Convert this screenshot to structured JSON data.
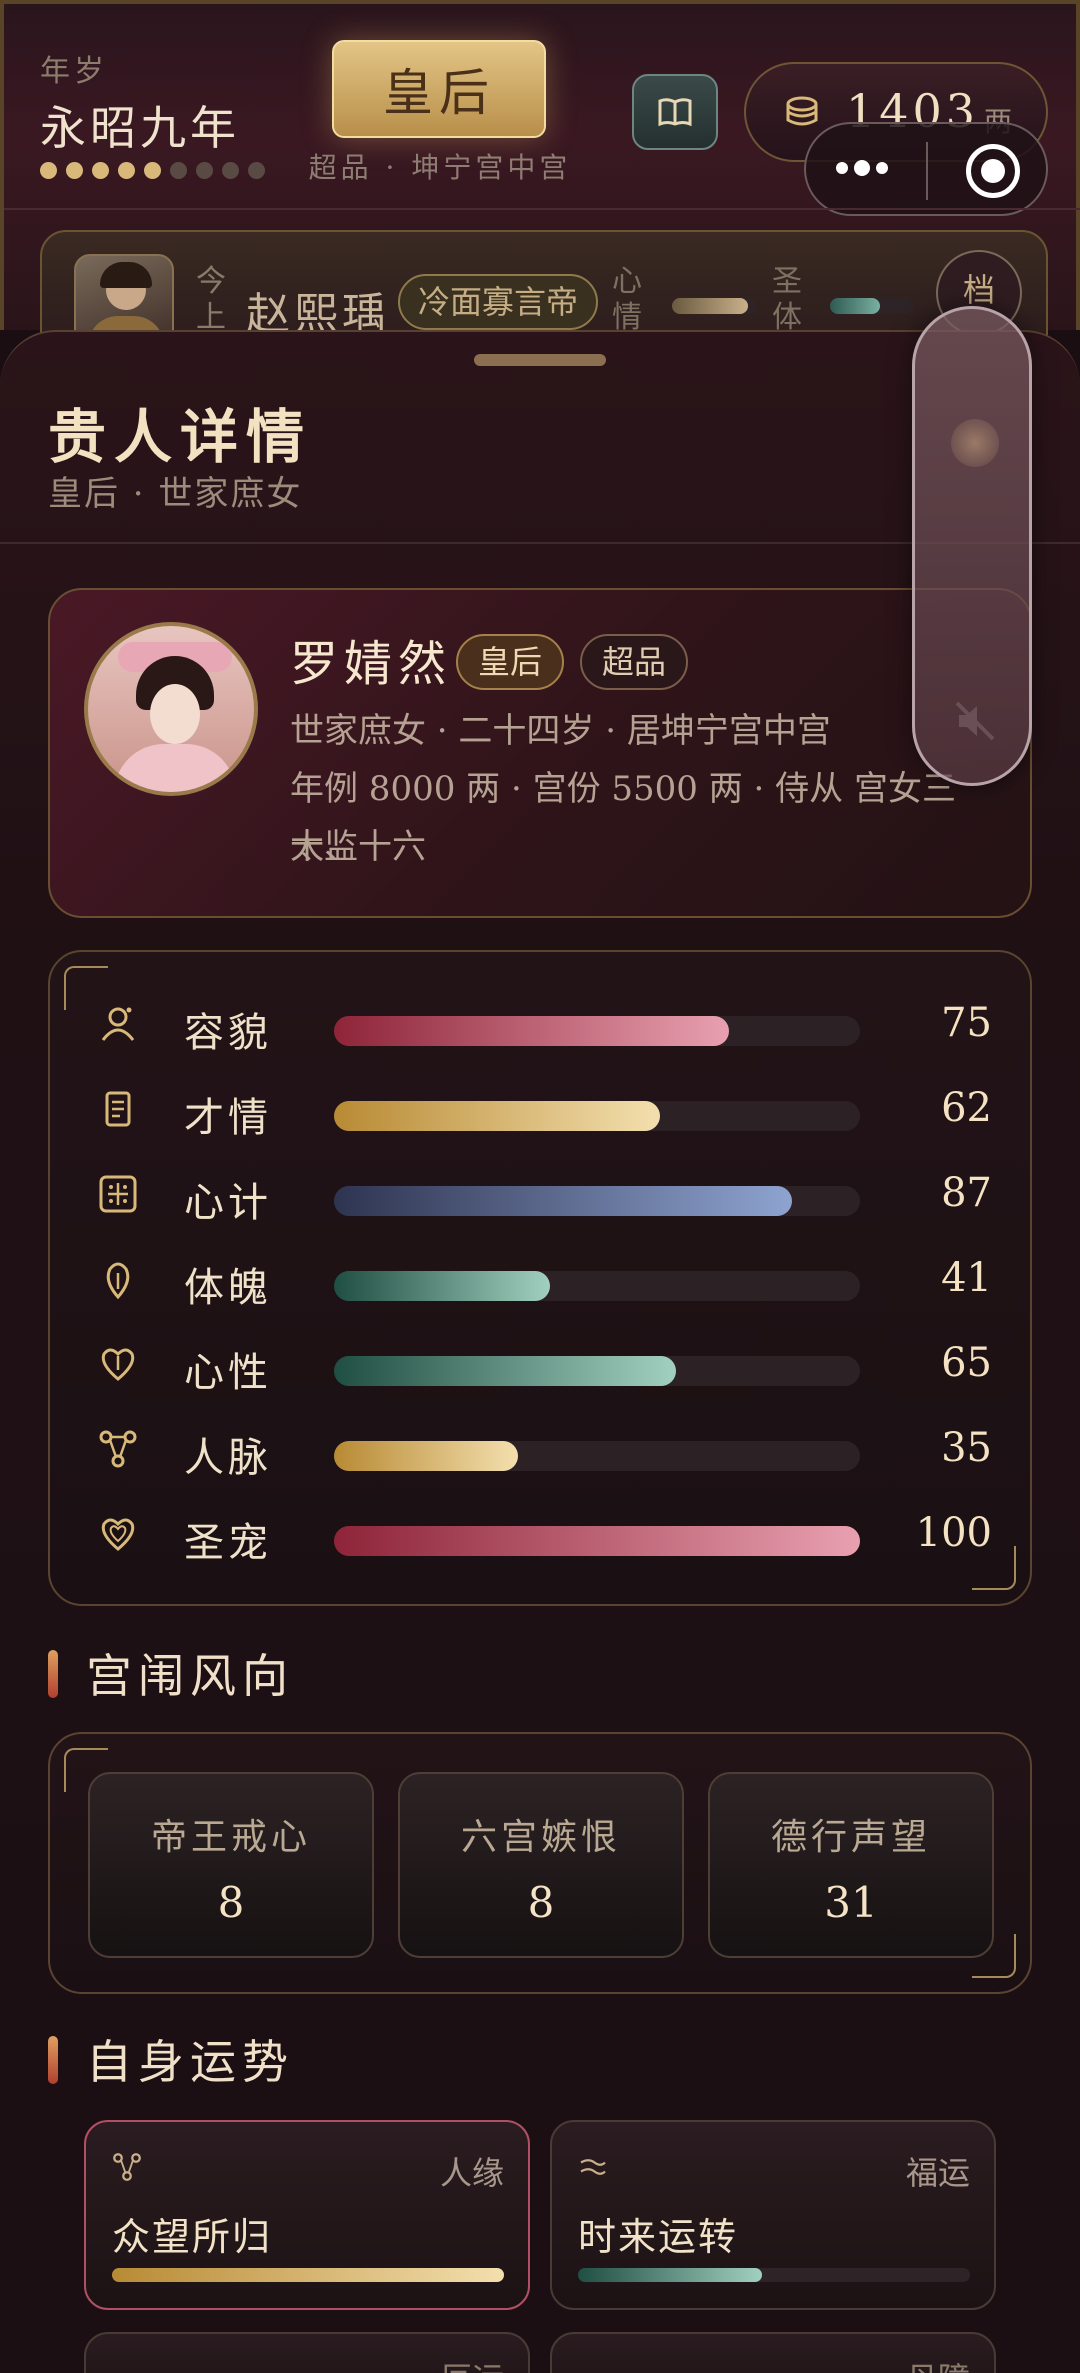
{
  "header": {
    "year_label": "年岁",
    "year_value": "永昭九年",
    "progress_dots": {
      "filled": 5,
      "total": 9
    },
    "rank": "皇后",
    "rank_sub": "超品 · 坤宁宫中宫",
    "coin_value": "1403",
    "coin_unit": "两",
    "book_icon": "book-icon"
  },
  "emperor": {
    "tag": "今上",
    "name": "赵熙瑀",
    "trait": "冷面寡言帝",
    "mood_label": "心情",
    "mood_level": 0.9,
    "health_label": "圣体",
    "health_level": 0.6,
    "archive_label": "档"
  },
  "sheet": {
    "title": "贵人详情",
    "subtitle": "皇后 · 世家庶女"
  },
  "profile": {
    "name": "罗婧然",
    "badge_rank": "皇后",
    "badge_grade": "超品",
    "line1": "世家庶女 · 二十四岁 · 居坤宁宫中宫",
    "line2": "年例 8000 两 · 宫份 5500 两 · 侍从 宫女三十、",
    "line3": "太监十六"
  },
  "stats": [
    {
      "label": "容貌",
      "value": "75",
      "icon": "person-icon"
    },
    {
      "label": "才情",
      "value": "62",
      "icon": "scroll-icon"
    },
    {
      "label": "心计",
      "value": "87",
      "icon": "abacus-icon"
    },
    {
      "label": "体魄",
      "value": "41",
      "icon": "leaf-icon"
    },
    {
      "label": "心性",
      "value": "65",
      "icon": "heart-icon"
    },
    {
      "label": "人脉",
      "value": "35",
      "icon": "network-icon"
    },
    {
      "label": "圣宠",
      "value": "100",
      "icon": "favor-heart-icon"
    }
  ],
  "rumors_title": "宫闱风向",
  "rumors": [
    {
      "label": "帝王戒心",
      "value": "8"
    },
    {
      "label": "六宫嫉恨",
      "value": "8"
    },
    {
      "label": "德行声望",
      "value": "31"
    }
  ],
  "fortune_title": "自身运势",
  "fortunes": [
    {
      "category": "人缘",
      "title": "众望所归",
      "level": 1.0,
      "icon": "network-icon"
    },
    {
      "category": "福运",
      "title": "时来运转",
      "level": 0.47,
      "icon": "wind-icon"
    }
  ],
  "fortune_peek": [
    "厄运",
    "丹障"
  ],
  "colors": {
    "gold": "#d8b97a",
    "crimson_bar": "#e8a0b0",
    "gold_bar": "#f3dfae",
    "blue_bar": "#8ea3d0",
    "green_bar": "#a2d0c0"
  }
}
